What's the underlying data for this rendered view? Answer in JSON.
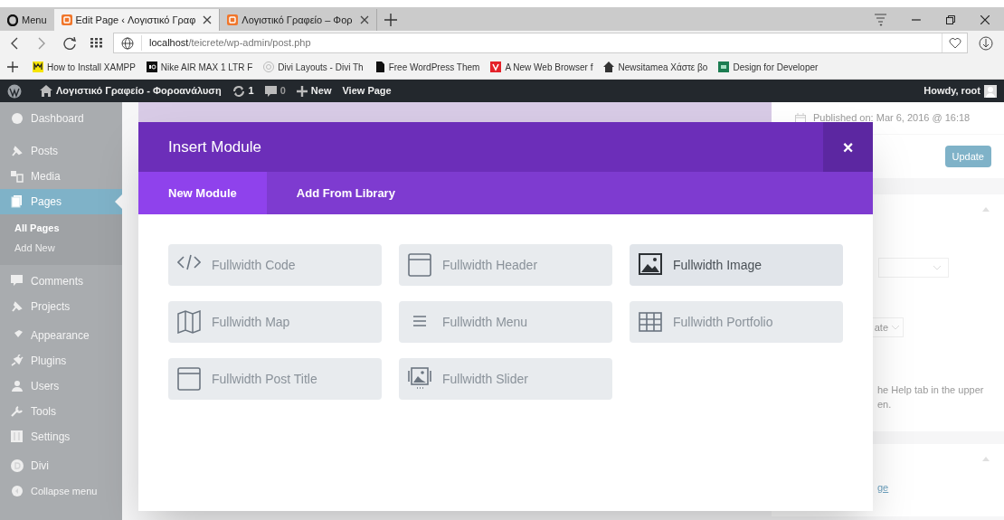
{
  "browser": {
    "menu_label": "Menu",
    "tabs": [
      {
        "label": "Edit Page ‹ Λογιστικό Γραφ",
        "selected": true
      },
      {
        "label": "Λογιστικό Γραφείο – Φορ",
        "selected": false
      }
    ],
    "address": {
      "host": "localhost",
      "path": "/teicrete/wp-admin/post.php"
    },
    "bookmarks": [
      "How to Install XAMPP",
      "Nike AIR MAX 1 LTR F",
      "Divi Layouts - Divi Th",
      "Free WordPress Them",
      "A New Web Browser f",
      "Newsitamea Χάστε βο",
      "Design for Developer"
    ]
  },
  "admin_bar": {
    "site_name": "Λογιστικό Γραφείο - Φοροανάλυση",
    "updates": "1",
    "comments": "0",
    "new": "New",
    "view": "View Page",
    "greeting": "Howdy, root"
  },
  "sidebar": {
    "items": [
      {
        "label": "Dashboard",
        "selected": false
      },
      {
        "label": "Posts",
        "selected": false
      },
      {
        "label": "Media",
        "selected": false
      },
      {
        "label": "Pages",
        "selected": true,
        "children": [
          {
            "label": "All Pages",
            "selected": true
          },
          {
            "label": "Add New",
            "selected": false
          }
        ]
      },
      {
        "label": "Comments",
        "selected": false
      },
      {
        "label": "Projects",
        "selected": false
      },
      {
        "label": "Appearance",
        "selected": false
      },
      {
        "label": "Plugins",
        "selected": false
      },
      {
        "label": "Users",
        "selected": false
      },
      {
        "label": "Tools",
        "selected": false
      },
      {
        "label": "Settings",
        "selected": false
      },
      {
        "label": "Divi",
        "selected": false
      },
      {
        "label": "Collapse menu",
        "selected": false
      }
    ]
  },
  "side_panel": {
    "published": "Published on: Mar 6, 2016 @ 16:18",
    "button": "Update",
    "select_text": "ate",
    "help_lines": [
      "he Help tab in the upper",
      "en."
    ],
    "link": "ge"
  },
  "modal": {
    "title": "Insert Module",
    "close": "×",
    "tabs": [
      {
        "label": "New Module",
        "selected": true
      },
      {
        "label": "Add From Library",
        "selected": false
      }
    ],
    "modules": [
      {
        "label": "Fullwidth Code",
        "highlighted": false
      },
      {
        "label": "Fullwidth Header",
        "highlighted": false
      },
      {
        "label": "Fullwidth Image",
        "highlighted": true
      },
      {
        "label": "Fullwidth Map",
        "highlighted": false
      },
      {
        "label": "Fullwidth Menu",
        "highlighted": false
      },
      {
        "label": "Fullwidth Portfolio",
        "highlighted": false
      },
      {
        "label": "Fullwidth Post Title",
        "highlighted": false
      },
      {
        "label": "Fullwidth Slider",
        "highlighted": false
      }
    ]
  }
}
